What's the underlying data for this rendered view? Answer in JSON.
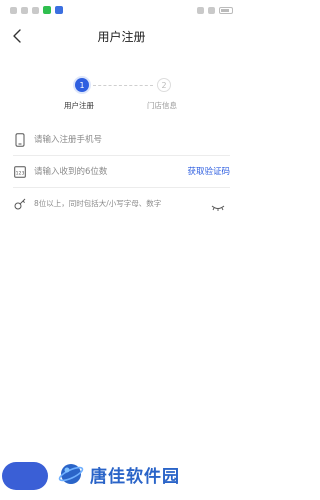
{
  "statusbar": {
    "left_icons": [
      "notification-icon",
      "wechat-icon",
      "app-icon"
    ],
    "right_icons": [
      "signal-icon",
      "wifi-icon",
      "battery-icon"
    ]
  },
  "header": {
    "title": "用户注册",
    "back_icon": "chevron-left-icon"
  },
  "steps": [
    {
      "number": "1",
      "label": "用户注册",
      "active": true
    },
    {
      "number": "2",
      "label": "门店信息",
      "active": false
    }
  ],
  "form": {
    "phone": {
      "placeholder": "请输入注册手机号",
      "icon": "phone-icon"
    },
    "code": {
      "placeholder": "请输入收到的6位数",
      "icon": "sms-code-icon",
      "action_label": "获取验证码"
    },
    "password": {
      "placeholder": "8位以上，同时包括大/小写字母、数字",
      "icon": "key-icon",
      "toggle_icon": "eye-closed-icon"
    }
  },
  "watermark": {
    "text": "唐佳软件园",
    "logo": "globe-logo"
  },
  "colors": {
    "accent": "#2f5fe0",
    "text_primary": "#222222",
    "placeholder": "#8a8a8a",
    "step_inactive": "#999999"
  }
}
